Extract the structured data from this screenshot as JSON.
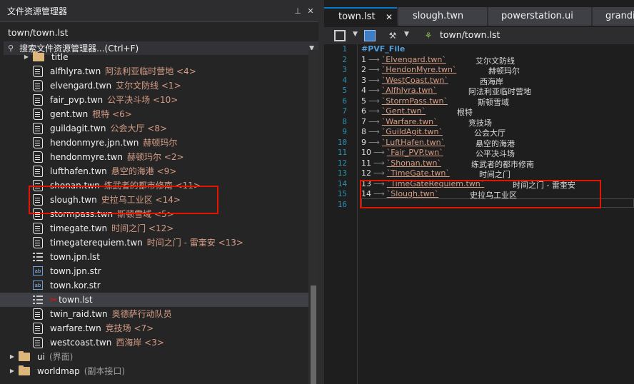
{
  "explorer": {
    "title": "文件资源管理器",
    "pin_glyph": "⊥",
    "close_glyph": "✕",
    "path": "town/town.lst",
    "search_placeholder": "搜索文件资源管理器...(Ctrl+F)",
    "items": [
      {
        "name": "title",
        "desc": "",
        "icon": "folder-icon",
        "expander": "▶"
      },
      {
        "name": "alfhlyra.twn",
        "desc": "阿法利亚临时营地 <4>",
        "icon": "scroll-file-icon"
      },
      {
        "name": "elvengard.twn",
        "desc": "艾尔文防线 <1>",
        "icon": "scroll-file-icon"
      },
      {
        "name": "fair_pvp.twn",
        "desc": "公平决斗场 <10>",
        "icon": "scroll-file-icon"
      },
      {
        "name": "gent.twn",
        "desc": "根特 <6>",
        "icon": "scroll-file-icon"
      },
      {
        "name": "guildagit.twn",
        "desc": "公会大厅 <8>",
        "icon": "scroll-file-icon"
      },
      {
        "name": "hendonmyre.jpn.twn",
        "desc": "赫顿玛尔",
        "icon": "scroll-file-icon"
      },
      {
        "name": "hendonmyre.twn",
        "desc": "赫顿玛尔 <2>",
        "icon": "scroll-file-icon"
      },
      {
        "name": "lufthafen.twn",
        "desc": "悬空的海港 <9>",
        "icon": "scroll-file-icon"
      },
      {
        "name": "shonan.twn",
        "desc": "练武者的都市修南 <11>",
        "icon": "scroll-file-icon"
      },
      {
        "name": "slough.twn",
        "desc": "史拉乌工业区 <14>",
        "icon": "scroll-file-icon"
      },
      {
        "name": "stormpass.twn",
        "desc": "斯顿雪域 <5>",
        "icon": "scroll-file-icon"
      },
      {
        "name": "timegate.twn",
        "desc": "时间之门 <12>",
        "icon": "scroll-file-icon"
      },
      {
        "name": "timegaterequiem.twn",
        "desc": "时间之门 - 雷奎安 <13>",
        "icon": "scroll-file-icon"
      },
      {
        "name": "town.jpn.lst",
        "desc": "",
        "icon": "list-file-icon"
      },
      {
        "name": "town.jpn.str",
        "desc": "",
        "icon": "str-file-icon"
      },
      {
        "name": "town.kor.str",
        "desc": "",
        "icon": "str-file-icon"
      },
      {
        "name": "town.lst",
        "desc": "",
        "icon": "list-file-icon",
        "selected": true,
        "modified": "✂"
      },
      {
        "name": "twin_raid.twn",
        "desc": "奥德萨行动队员",
        "icon": "scroll-file-icon"
      },
      {
        "name": "warfare.twn",
        "desc": "竞技场 <7>",
        "icon": "scroll-file-icon"
      },
      {
        "name": "westcoast.twn",
        "desc": "西海岸 <3>",
        "icon": "scroll-file-icon"
      },
      {
        "name": "ui",
        "desc": "(界面)",
        "icon": "folder-icon",
        "expander": "▶",
        "gray": true
      },
      {
        "name": "worldmap",
        "desc": "(副本接口)",
        "icon": "folder-icon",
        "expander": "▶",
        "gray": true
      }
    ]
  },
  "tabs": [
    {
      "label": "town.lst",
      "active": true,
      "close": "✕"
    },
    {
      "label": "slough.twn"
    },
    {
      "label": "powerstation.ui"
    },
    {
      "label": "grandis"
    }
  ],
  "toolbar": {
    "path": "town/town.lst"
  },
  "editor": {
    "header": "#PVF_File",
    "arrow": "⟶",
    "lines": [
      {
        "n": "1",
        "key": "1",
        "file": "`Elvengard.twn`",
        "desc": "艾尔文防线"
      },
      {
        "n": "2",
        "key": "2",
        "file": "`HendonMyre.twn`",
        "desc": "赫顿玛尔"
      },
      {
        "n": "3",
        "key": "3",
        "file": "`WestCoast.twn`",
        "desc": "西海岸"
      },
      {
        "n": "4",
        "key": "4",
        "file": "`Alfhlyra.twn`",
        "desc": "阿法利亚临时营地"
      },
      {
        "n": "5",
        "key": "5",
        "file": "`StormPass.twn`",
        "desc": "斯顿雪域"
      },
      {
        "n": "6",
        "key": "6",
        "file": "`Gent.twn`",
        "desc": "根特"
      },
      {
        "n": "7",
        "key": "7",
        "file": "`Warfare.twn`",
        "desc": "竞技场"
      },
      {
        "n": "8",
        "key": "8",
        "file": "`GuildAgit.twn`",
        "desc": "公会大厅"
      },
      {
        "n": "9",
        "key": "9",
        "file": "`LuftHafen.twn`",
        "desc": "悬空的海港"
      },
      {
        "n": "10",
        "key": "10",
        "file": "`Fair_PVP.twn`",
        "desc": "公平决斗场"
      },
      {
        "n": "11",
        "key": "11",
        "file": "`Shonan.twn`",
        "desc": "练武者的都市修南"
      },
      {
        "n": "12",
        "key": "12",
        "file": "`TimeGate.twn`",
        "desc": "时间之门"
      },
      {
        "n": "13",
        "key": "13",
        "file": "`TimeGateRequiem.twn`",
        "desc": "时间之门 - 雷奎安"
      },
      {
        "n": "14",
        "key": "14",
        "file": "`Slough.twn`",
        "desc": "史拉乌工业区"
      }
    ],
    "last_line_number": "16"
  }
}
